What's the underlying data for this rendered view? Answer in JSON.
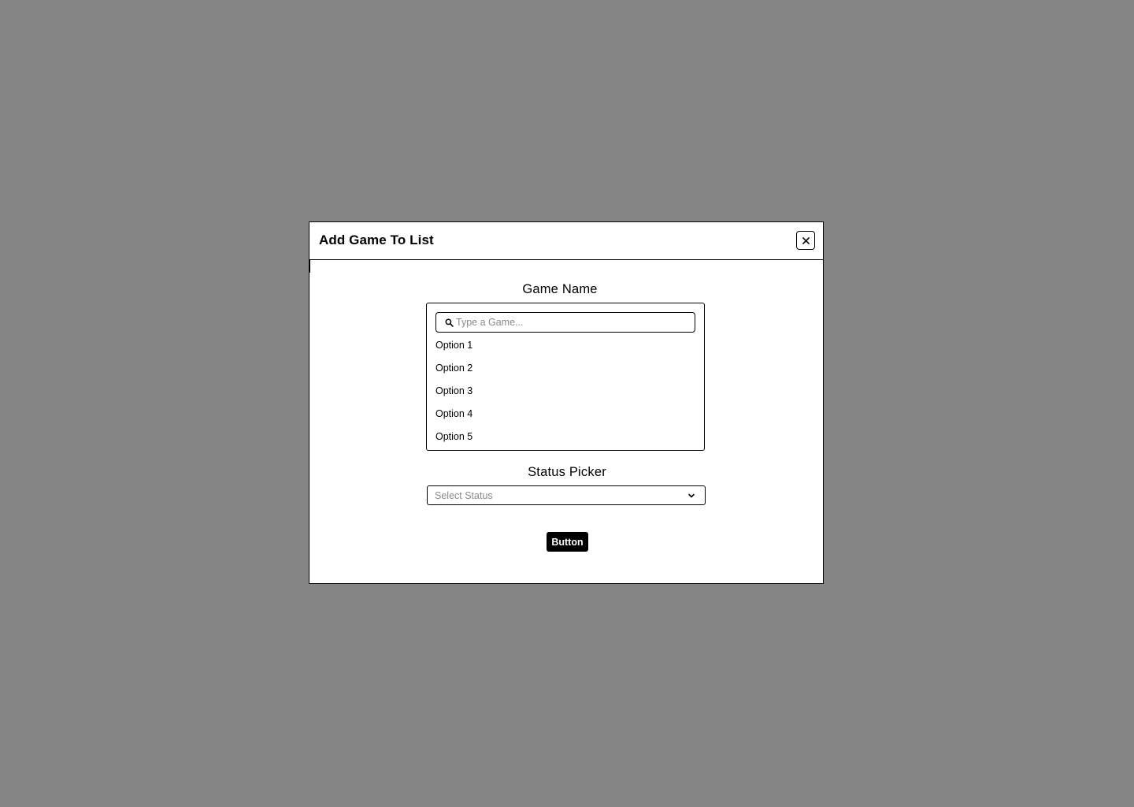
{
  "modal": {
    "title": "Add Game To List",
    "close_label": "×"
  },
  "game_name": {
    "label": "Game Name",
    "search": {
      "placeholder": "Type a Game...",
      "value": "",
      "icon": "search-icon"
    },
    "options": [
      "Option 1",
      "Option 2",
      "Option 3",
      "Option 4",
      "Option 5"
    ]
  },
  "status": {
    "label": "Status Picker",
    "placeholder": "Select Status",
    "icon": "chevron-down-icon"
  },
  "submit": {
    "label": "Button"
  },
  "colors": {
    "overlay": "#858585",
    "surface": "#ffffff",
    "border": "#000000",
    "placeholder": "#8a8a8a",
    "button_bg": "#000000",
    "button_text": "#ffffff"
  }
}
